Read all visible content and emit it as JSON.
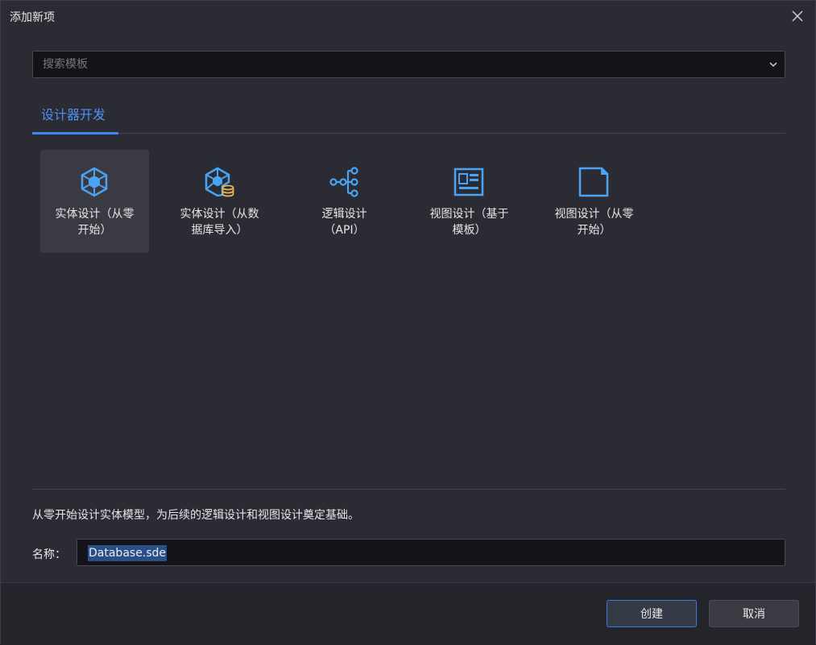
{
  "dialog": {
    "title": "添加新项",
    "close_icon": "close-icon"
  },
  "search": {
    "placeholder": "搜索模板",
    "value": ""
  },
  "tabs": [
    {
      "label": "设计器开发",
      "active": true
    }
  ],
  "templates": [
    {
      "label": "实体设计（从零\n开始）",
      "icon": "entity-cube-icon",
      "selected": true
    },
    {
      "label": "实体设计（从数\n据库导入）",
      "icon": "entity-database-icon",
      "selected": false
    },
    {
      "label": "逻辑设计\n（API）",
      "icon": "logic-flow-icon",
      "selected": false
    },
    {
      "label": "视图设计（基于\n模板）",
      "icon": "view-template-icon",
      "selected": false
    },
    {
      "label": "视图设计（从零\n开始）",
      "icon": "blank-page-icon",
      "selected": false
    }
  ],
  "description": "从零开始设计实体模型，为后续的逻辑设计和视图设计奠定基础。",
  "name_field": {
    "label": "名称：",
    "value": "Database.sde"
  },
  "buttons": {
    "create": "创建",
    "cancel": "取消"
  },
  "colors": {
    "accent": "#3d84f5",
    "icon_blue": "#4aa3f5",
    "icon_db": "#e8b55a",
    "background": "#2b2c33"
  }
}
